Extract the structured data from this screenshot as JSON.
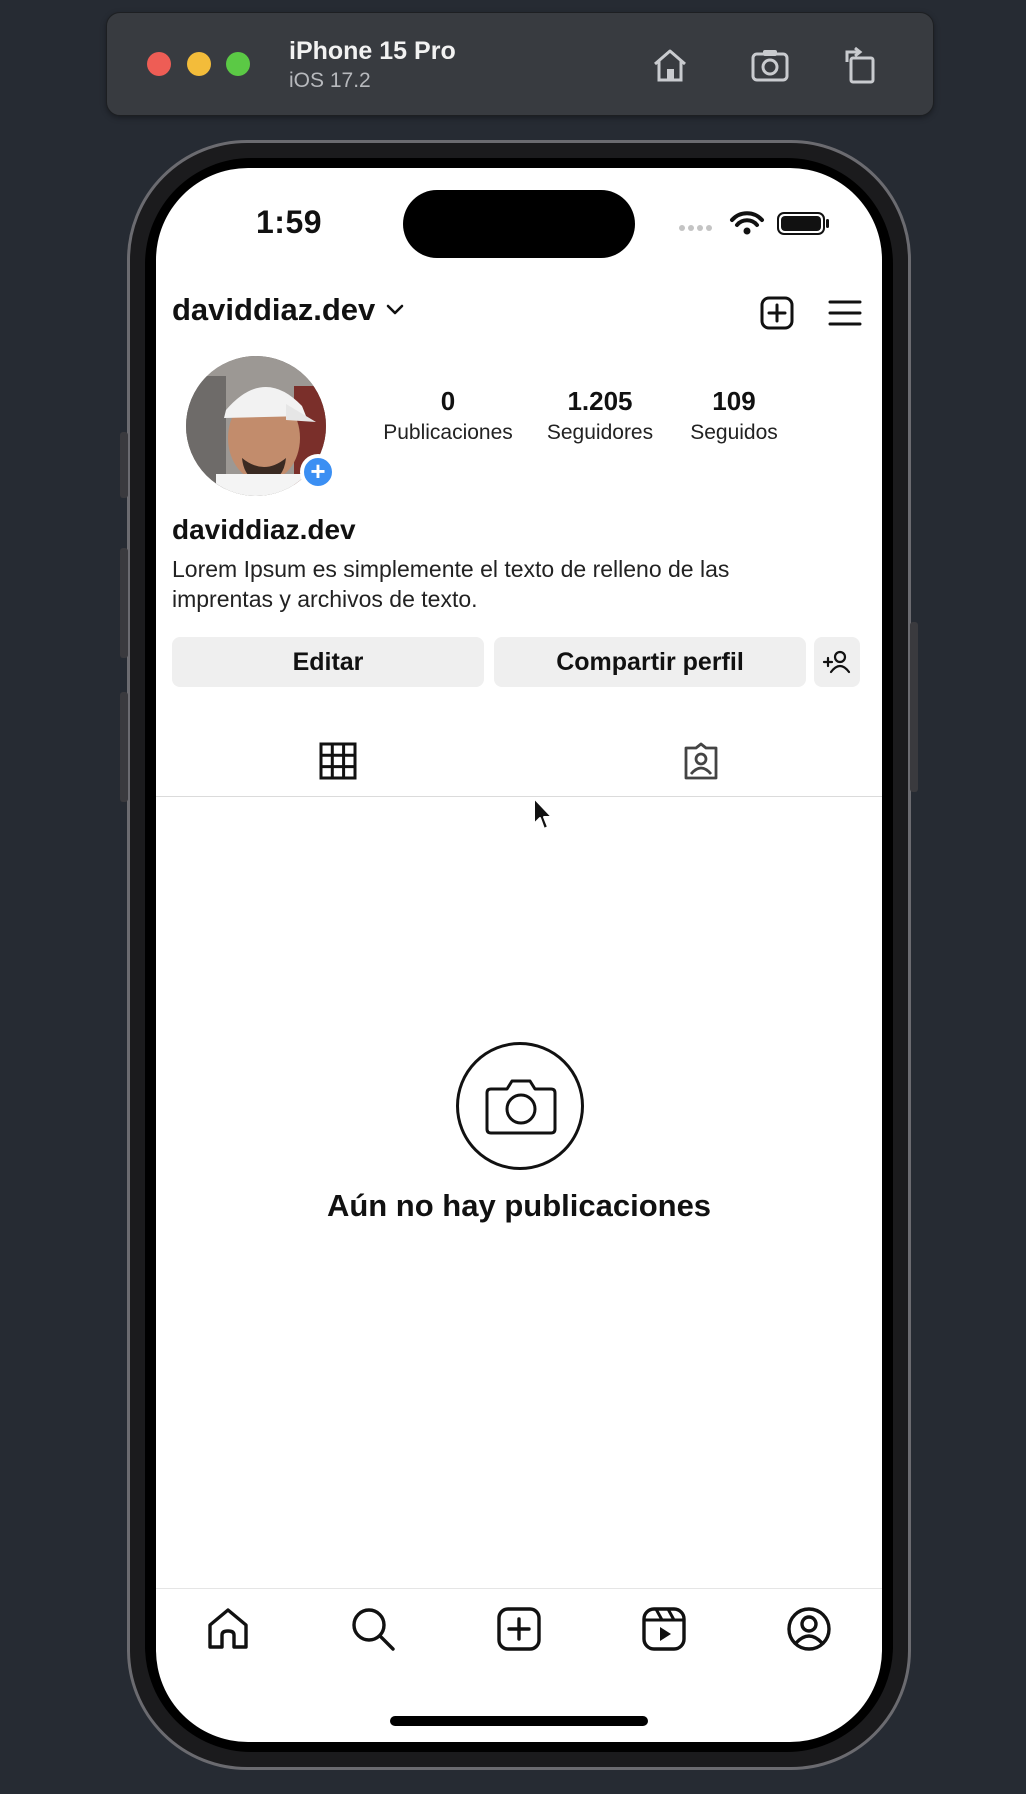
{
  "simulator": {
    "device_name": "iPhone 15 Pro",
    "os_version": "iOS 17.2"
  },
  "status_bar": {
    "time": "1:59"
  },
  "profile": {
    "username": "daviddiaz.dev",
    "display_name": "daviddiaz.dev",
    "bio": "Lorem Ipsum es simplemente el texto de relleno de las imprentas y archivos de texto.",
    "stats": [
      {
        "value": "0",
        "label": "Publicaciones"
      },
      {
        "value": "1.205",
        "label": "Seguidores"
      },
      {
        "value": "109",
        "label": "Seguidos"
      }
    ]
  },
  "actions": {
    "edit_label": "Editar",
    "share_label": "Compartir perfil"
  },
  "empty_state": {
    "message": "Aún no hay publicaciones"
  },
  "icons": {
    "create": "plus-square-icon",
    "menu": "hamburger-menu-icon",
    "add_person": "add-person-icon",
    "grid_tab": "grid-icon",
    "tagged_tab": "tagged-person-icon",
    "camera": "camera-icon",
    "nav": [
      "home-icon",
      "search-icon",
      "create-icon",
      "reels-icon",
      "profile-icon"
    ]
  },
  "colors": {
    "accent_blue": "#3b8ff3",
    "button_bg": "#efefef",
    "simulator_bg": "#262b33"
  }
}
